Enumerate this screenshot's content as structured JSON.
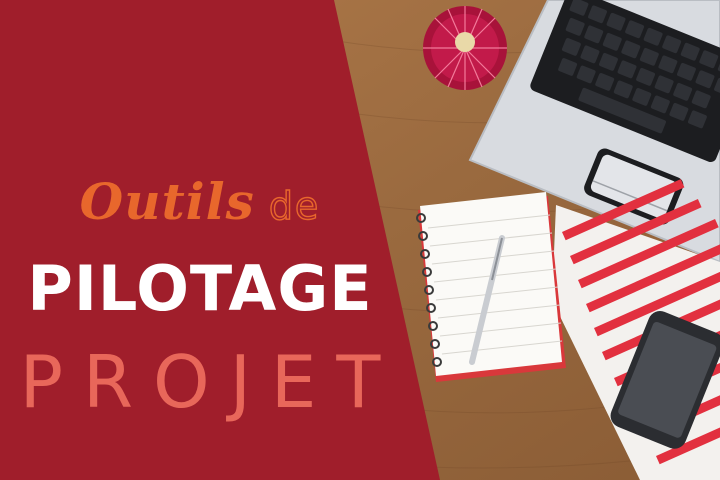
{
  "title": {
    "line1_script": "Outils",
    "line1_outline": "de",
    "line2": "PILOTAGE",
    "line3": "PROJET"
  },
  "colors": {
    "panel_red": "#a01e2b",
    "script_orange": "#e8672c",
    "projet_salmon": "#e8675a",
    "pilotage_white": "#ffffff",
    "desk_wood": "#9a6a3f"
  },
  "photo_objects": [
    "cactus-plant",
    "laptop",
    "spiral-notebook",
    "pen",
    "bar-chart-printout",
    "smartphone"
  ]
}
